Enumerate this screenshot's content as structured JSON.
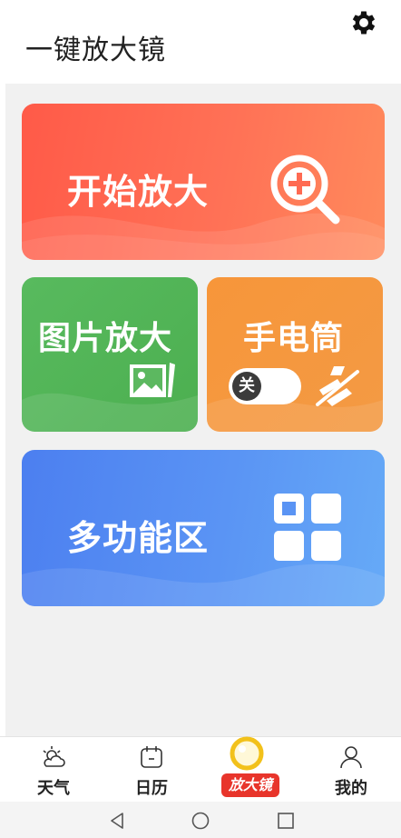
{
  "app": {
    "title": "一键放大镜"
  },
  "header": {
    "settings_icon": "gear-icon"
  },
  "cards": {
    "zoom": {
      "label": "开始放大",
      "icon": "zoom-in-icon",
      "color": "#ff6650"
    },
    "photo": {
      "label": "图片放大",
      "icon": "image-icon",
      "color": "#4caf50"
    },
    "torch": {
      "label": "手电筒",
      "toggle_label": "关",
      "toggle_state": "off",
      "icon": "flashlight-off-icon",
      "color": "#f5973f"
    },
    "multi": {
      "label": "多功能区",
      "icon": "grid-icon",
      "color": "#5590f3"
    }
  },
  "tabbar": {
    "items": [
      {
        "label": "天气",
        "icon": "weather-icon"
      },
      {
        "label": "日历",
        "icon": "calendar-icon"
      },
      {
        "label": "放大镜",
        "icon": "magnifier-icon",
        "active": true
      },
      {
        "label": "我的",
        "icon": "user-icon"
      }
    ]
  },
  "system_nav": {
    "back": "back-icon",
    "home": "home-icon",
    "recents": "recents-icon"
  }
}
